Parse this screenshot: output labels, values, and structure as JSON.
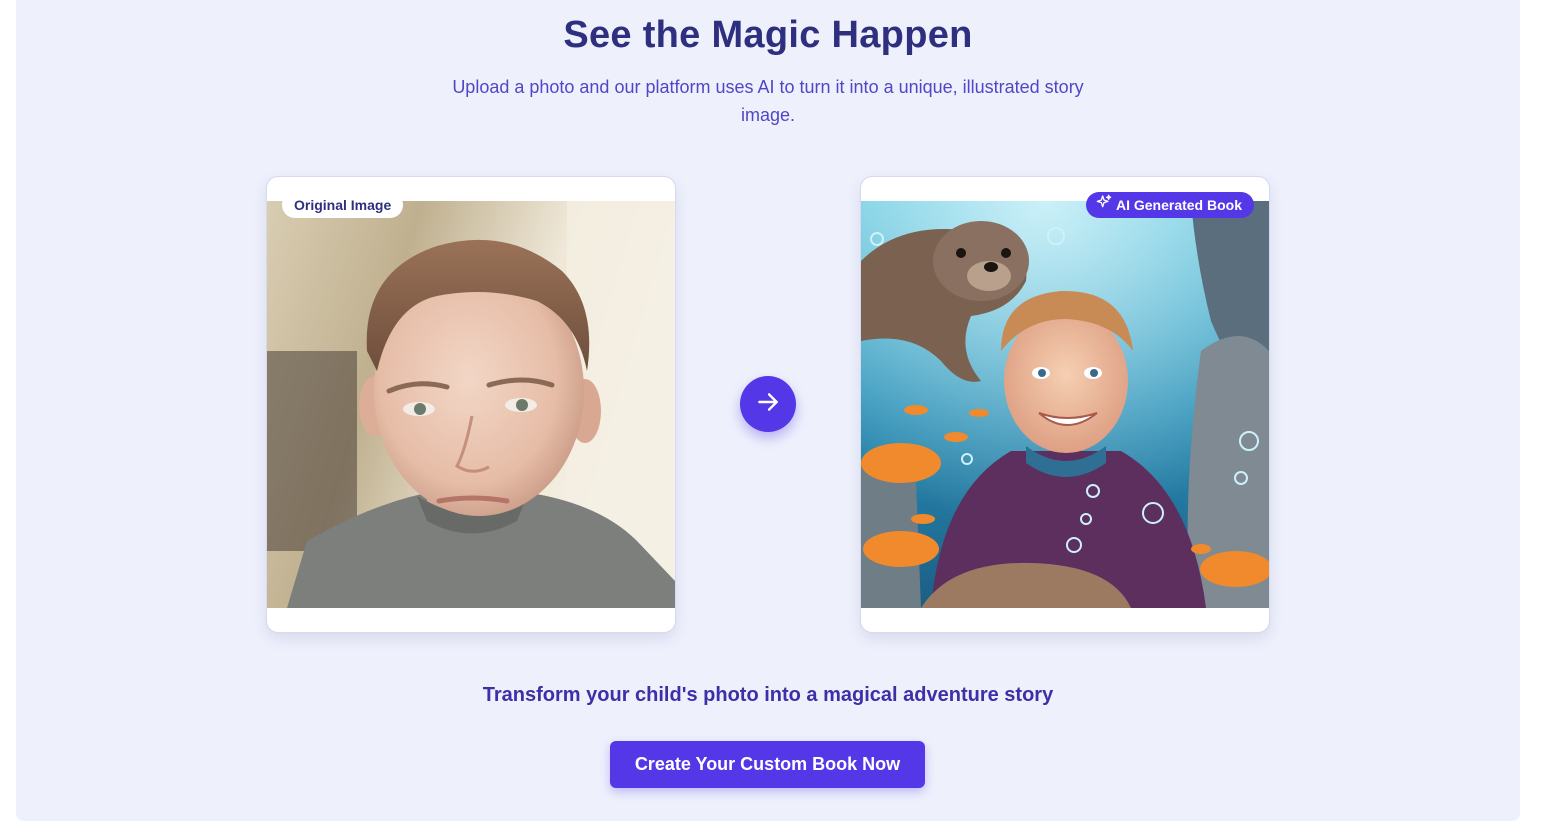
{
  "section": {
    "title": "See the Magic Happen",
    "subtitle": "Upload a photo and our platform uses AI to turn it into a unique, illustrated story image."
  },
  "original_card": {
    "badge": "Original Image",
    "image_alt": "Photo of a boy"
  },
  "arrow": {
    "icon": "arrow-right-icon"
  },
  "generated_card": {
    "badge": "AI Generated Book",
    "badge_icon": "sparkles-icon",
    "image_alt": "Illustrated boy underwater with a seal and fish"
  },
  "tagline": "Transform your child's photo into a magical adventure story",
  "cta": {
    "label": "Create Your Custom Book Now"
  },
  "colors": {
    "background": "#eef1fc",
    "title": "#2e2f7f",
    "accent": "#5438e8",
    "subtitle": "#4f46c8"
  }
}
